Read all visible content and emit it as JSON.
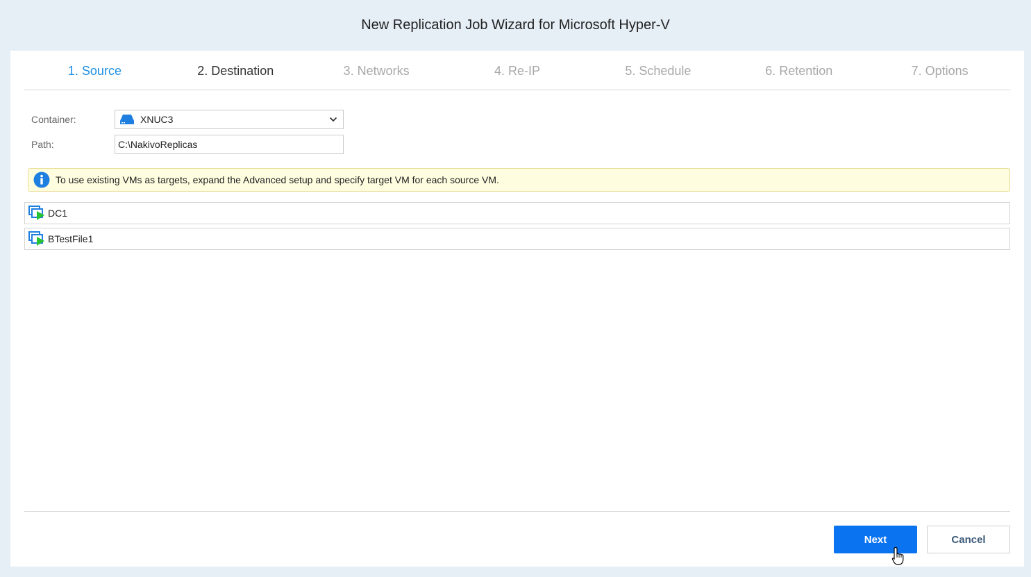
{
  "window": {
    "title": "New Replication Job Wizard for Microsoft Hyper-V"
  },
  "steps": [
    {
      "label": "1. Source",
      "state": "completed"
    },
    {
      "label": "2. Destination",
      "state": "current"
    },
    {
      "label": "3. Networks",
      "state": "pending"
    },
    {
      "label": "4. Re-IP",
      "state": "pending"
    },
    {
      "label": "5. Schedule",
      "state": "pending"
    },
    {
      "label": "6. Retention",
      "state": "pending"
    },
    {
      "label": "7. Options",
      "state": "pending"
    }
  ],
  "form": {
    "container_label": "Container:",
    "container_value": "XNUC3",
    "container_icon": "server-icon",
    "path_label": "Path:",
    "path_value": "C:\\NakivoReplicas"
  },
  "info": {
    "icon": "info-icon",
    "message": "To use existing VMs as targets, expand the Advanced setup and specify target VM for each source VM."
  },
  "vms": [
    {
      "name": "DC1",
      "icon": "vm-running-icon"
    },
    {
      "name": "BTestFile1",
      "icon": "vm-running-icon"
    }
  ],
  "buttons": {
    "next": "Next",
    "cancel": "Cancel"
  },
  "colors": {
    "accent": "#0a73f0",
    "active_step": "#1e8fe6",
    "info_bg": "#fffde0",
    "vm_play": "#27c233"
  }
}
